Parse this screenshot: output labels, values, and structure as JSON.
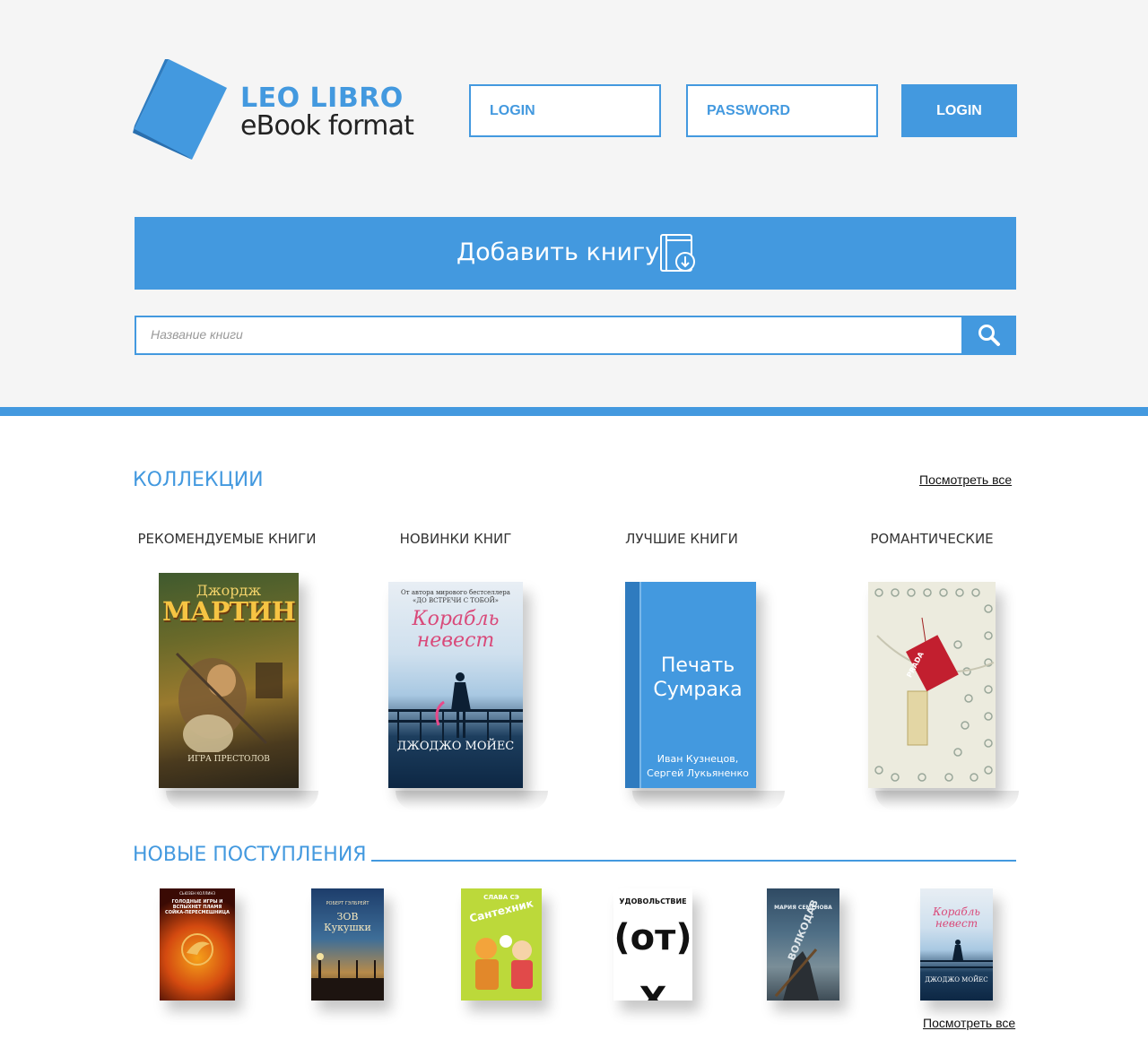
{
  "logo": {
    "title": "LEO LIBRO",
    "subtitle": "eBook format",
    "icon": "book-icon"
  },
  "auth": {
    "login_placeholder": "LOGIN",
    "password_placeholder": "PASSWORD",
    "login_button": "LOGIN"
  },
  "add_book": {
    "label": "Добавить книгу",
    "icon": "book-download-icon"
  },
  "search": {
    "placeholder": "Название книги",
    "icon": "search-icon"
  },
  "collections": {
    "title": "КОЛЛЕКЦИИ",
    "see_all": "Посмотреть все",
    "items": [
      {
        "label": "РЕКОМЕНДУЕМЫЕ КНИГИ",
        "cover": {
          "top_line": "Джордж",
          "title": "МАРТИН",
          "bottom_line": "ИГРА ПРЕСТОЛОВ"
        }
      },
      {
        "label": "НОВИНКИ КНИГ",
        "cover": {
          "top_line": "От автора мирового бестселлера «ДО ВСТРЕЧИ С ТОБОЙ»",
          "title": "Корабль невест",
          "author": "ДЖОДЖО МОЙЕС"
        }
      },
      {
        "label": "ЛУЧШИЕ КНИГИ",
        "cover": {
          "title": "Печать Сумрака",
          "authors": "Иван Кузнецов, Сергей Лукьяненко"
        }
      },
      {
        "label": "РОМАНТИЧЕСКИЕ",
        "cover": {
          "tag": "PRADA"
        }
      }
    ]
  },
  "new_arrivals": {
    "title": "НОВЫЕ ПОСТУПЛЕНИЯ",
    "see_all": "Посмотреть все",
    "books": [
      {
        "top_line": "СЬЮЗЕН КОЛЛИНЗ",
        "title": "ГОЛОДНЫЕ ИГРЫ И ВСПЫХНЕТ ПЛАМЯ СОЙКА-ПЕРЕСМЕШНИЦА"
      },
      {
        "top_line": "РОБЕРТ ГЭЛБРЕЙТ",
        "title": "ЗОВ Кукушки"
      },
      {
        "top_line": "СЛАВА СЭ",
        "title": "Сантехник"
      },
      {
        "top_line": "УДОВОЛЬСТВИЕ",
        "title": "(от) X"
      },
      {
        "top_line": "МАРИЯ СЕМЁНОВА",
        "title": "ВОЛКОДАВ"
      },
      {
        "top_line": "ДЖОДЖО МОЙЕС",
        "title": "Корабль невест"
      }
    ]
  },
  "colors": {
    "accent": "#4399df",
    "header_bg": "#f5f5f5"
  }
}
